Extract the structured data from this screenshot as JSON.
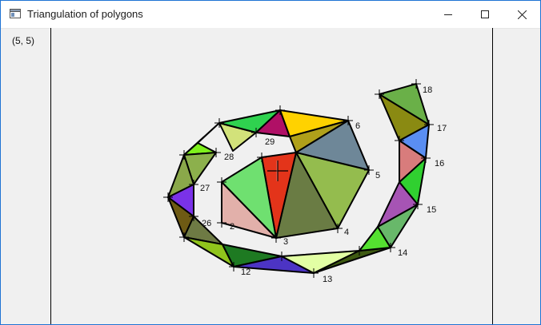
{
  "window": {
    "title": "Triangulation of polygons",
    "controls": {
      "minimize": "minimize",
      "maximize": "maximize",
      "close": "close"
    }
  },
  "status": {
    "coordinates": "(5, 5)"
  },
  "canvas": {
    "visible_vertex_labels": [
      "2",
      "3",
      "4",
      "5",
      "6",
      "12",
      "13",
      "14",
      "15",
      "16",
      "17",
      "18",
      "26",
      "27",
      "28",
      "29"
    ],
    "cursor": "crosshair"
  }
}
